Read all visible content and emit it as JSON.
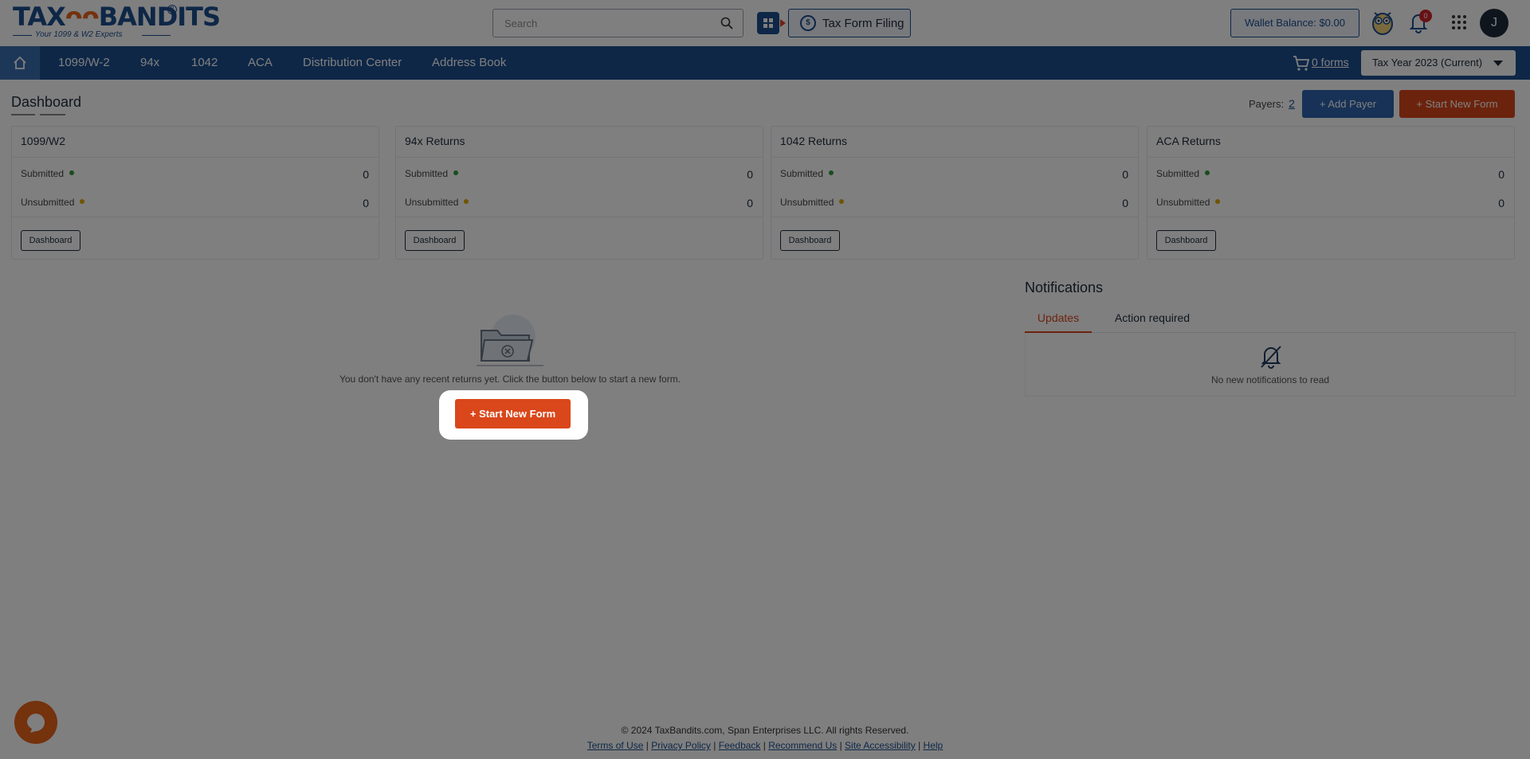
{
  "header": {
    "logo_text_left": "TAX",
    "logo_text_right": "BANDITS",
    "logo_tagline": "Your 1099 & W2 Experts",
    "search_placeholder": "Search",
    "tax_form_filing": "Tax Form Filing",
    "wallet_balance": "Wallet Balance: $0.00",
    "notification_count": "0",
    "avatar_initial": "J"
  },
  "nav": {
    "items": [
      "1099/W-2",
      "94x",
      "1042",
      "ACA",
      "Distribution Center",
      "Address Book"
    ],
    "cart_label": "0 forms",
    "tax_year": "Tax Year 2023 (Current)"
  },
  "dashboard": {
    "title": "Dashboard",
    "payers_label": "Payers:",
    "payers_count": "2",
    "add_payer": "+ Add Payer",
    "start_new_form": "+ Start New Form",
    "cards": [
      {
        "title": "1099/W2",
        "submitted_label": "Submitted",
        "submitted": "0",
        "unsubmitted_label": "Unsubmitted",
        "unsubmitted": "0",
        "button": "Dashboard"
      },
      {
        "title": "94x Returns",
        "submitted_label": "Submitted",
        "submitted": "0",
        "unsubmitted_label": "Unsubmitted",
        "unsubmitted": "0",
        "button": "Dashboard"
      },
      {
        "title": "1042 Returns",
        "submitted_label": "Submitted",
        "submitted": "0",
        "unsubmitted_label": "Unsubmitted",
        "unsubmitted": "0",
        "button": "Dashboard"
      },
      {
        "title": "ACA Returns",
        "submitted_label": "Submitted",
        "submitted": "0",
        "unsubmitted_label": "Unsubmitted",
        "unsubmitted": "0",
        "button": "Dashboard"
      }
    ],
    "empty_message": "You don't have any recent returns yet. Click the button below to start a new form.",
    "start_new_form_center": "+ Start New Form"
  },
  "notifications": {
    "title": "Notifications",
    "tabs": [
      "Updates",
      "Action required"
    ],
    "active_tab": "Updates",
    "empty_message": "No new notifications to read"
  },
  "footer": {
    "copyright": "© 2024 TaxBandits.com, Span Enterprises LLC. All rights Reserved.",
    "links": [
      "Terms of Use",
      "Privacy Policy",
      "Feedback",
      "Recommend Us",
      "Site Accessibility",
      "Help"
    ]
  },
  "colors": {
    "primary_blue": "#1d4e8f",
    "accent_orange": "#d9471b",
    "submitted_dot": "#2e9b3c",
    "unsubmitted_dot": "#e0a800"
  }
}
